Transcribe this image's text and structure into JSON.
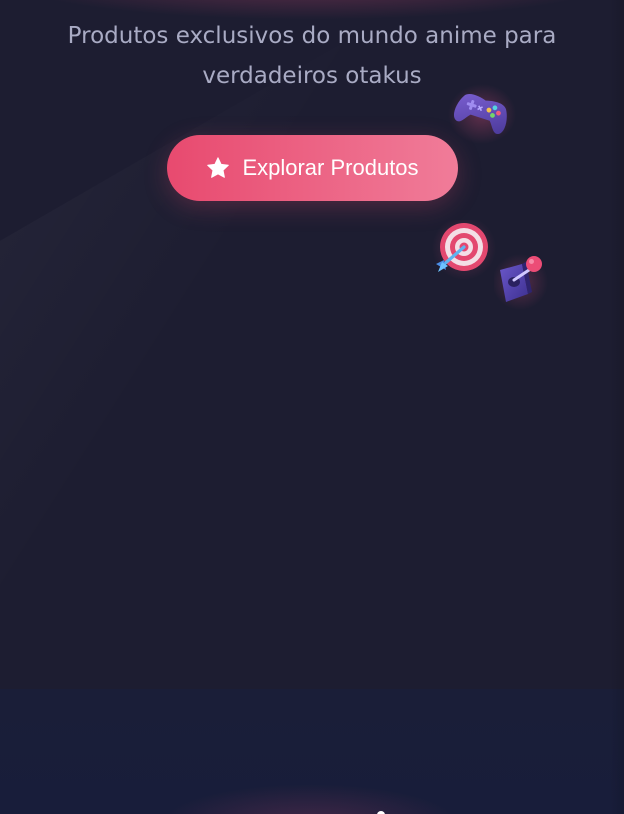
{
  "hero": {
    "subtitle": "Produtos exclusivos do mundo anime para verdadeiros otakus",
    "cta_label": "Explorar Produtos",
    "cta_icon": "star-icon"
  },
  "decorations": {
    "icons": [
      "gamepad-icon",
      "target-icon",
      "joystick-icon"
    ]
  },
  "colors": {
    "background": "#1d1d31",
    "accent_start": "#e84a6f",
    "accent_end": "#f07c99",
    "subtitle_text": "#a9abc4",
    "bottom_section": "#1a1e38"
  }
}
